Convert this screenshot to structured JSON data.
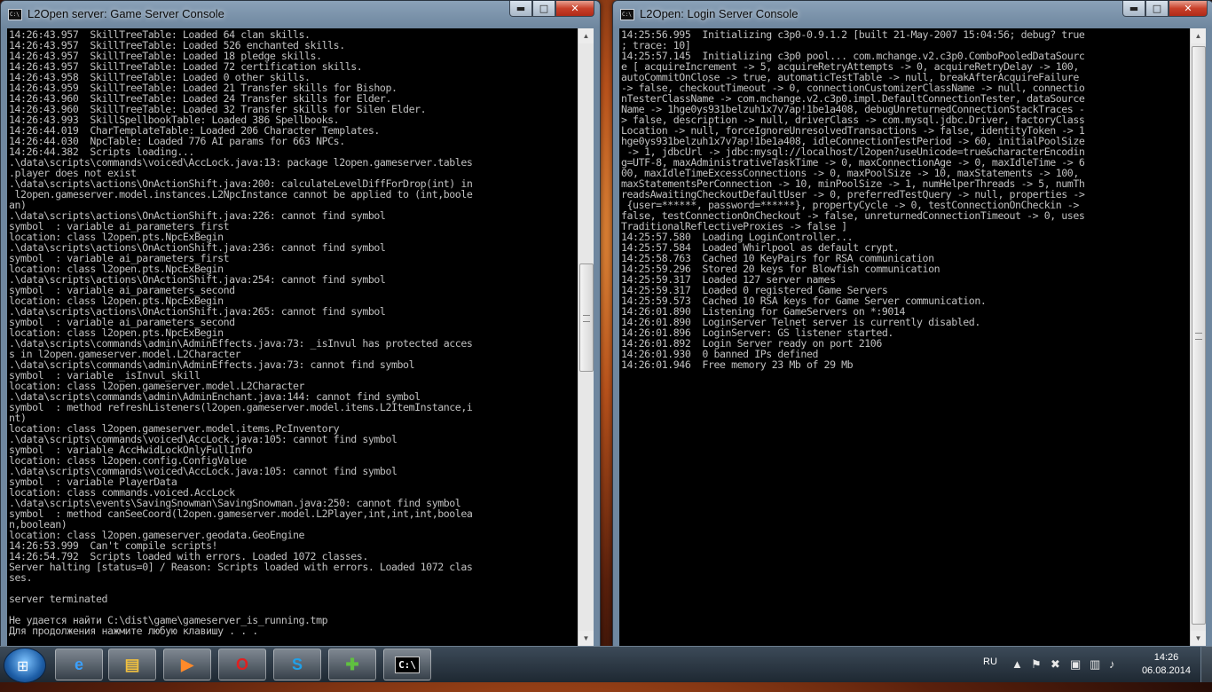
{
  "windows": {
    "game": {
      "title": "L2Open server: Game Server Console",
      "lines": [
        "14:26:43.957  SkillTreeTable: Loaded 64 clan skills.",
        "14:26:43.957  SkillTreeTable: Loaded 526 enchanted skills.",
        "14:26:43.957  SkillTreeTable: Loaded 18 pledge skills.",
        "14:26:43.957  SkillTreeTable: Loaded 72 certification skills.",
        "14:26:43.958  SkillTreeTable: Loaded 0 other skills.",
        "14:26:43.959  SkillTreeTable: Loaded 21 Transfer skills for Bishop.",
        "14:26:43.960  SkillTreeTable: Loaded 24 Transfer skills for Elder.",
        "14:26:43.960  SkillTreeTable: Loaded 32 Transfer skills for Silen Elder.",
        "14:26:43.993  SkillSpellbookTable: Loaded 386 Spellbooks.",
        "14:26:44.019  CharTemplateTable: Loaded 206 Character Templates.",
        "14:26:44.030  NpcTable: Loaded 776 AI params for 663 NPCs.",
        "14:26:44.382  Scripts loading...",
        ".\\data\\scripts\\commands\\voiced\\AccLock.java:13: package l2open.gameserver.tables",
        ".player does not exist",
        ".\\data\\scripts\\actions\\OnActionShift.java:200: calculateLevelDiffForDrop(int) in",
        " l2open.gameserver.model.instances.L2NpcInstance cannot be applied to (int,boole",
        "an)",
        ".\\data\\scripts\\actions\\OnActionShift.java:226: cannot find symbol",
        "symbol  : variable ai_parameters_first",
        "location: class l2open.pts.NpcExBegin",
        ".\\data\\scripts\\actions\\OnActionShift.java:236: cannot find symbol",
        "symbol  : variable ai_parameters_first",
        "location: class l2open.pts.NpcExBegin",
        ".\\data\\scripts\\actions\\OnActionShift.java:254: cannot find symbol",
        "symbol  : variable ai_parameters_second",
        "location: class l2open.pts.NpcExBegin",
        ".\\data\\scripts\\actions\\OnActionShift.java:265: cannot find symbol",
        "symbol  : variable ai_parameters_second",
        "location: class l2open.pts.NpcExBegin",
        ".\\data\\scripts\\commands\\admin\\AdminEffects.java:73: _isInvul has protected acces",
        "s in l2open.gameserver.model.L2Character",
        ".\\data\\scripts\\commands\\admin\\AdminEffects.java:73: cannot find symbol",
        "symbol  : variable _isInvul_skill",
        "location: class l2open.gameserver.model.L2Character",
        ".\\data\\scripts\\commands\\admin\\AdminEnchant.java:144: cannot find symbol",
        "symbol  : method refreshListeners(l2open.gameserver.model.items.L2ItemInstance,i",
        "nt)",
        "location: class l2open.gameserver.model.items.PcInventory",
        ".\\data\\scripts\\commands\\voiced\\AccLock.java:105: cannot find symbol",
        "symbol  : variable AccHwidLockOnlyFullInfo",
        "location: class l2open.config.ConfigValue",
        ".\\data\\scripts\\commands\\voiced\\AccLock.java:105: cannot find symbol",
        "symbol  : variable PlayerData",
        "location: class commands.voiced.AccLock",
        ".\\data\\scripts\\events\\SavingSnowman\\SavingSnowman.java:250: cannot find symbol",
        "symbol  : method canSeeCoord(l2open.gameserver.model.L2Player,int,int,int,boolea",
        "n,boolean)",
        "location: class l2open.gameserver.geodata.GeoEngine",
        "14:26:53.999  Can't compile scripts!",
        "14:26:54.792  Scripts loaded with errors. Loaded 1072 classes.",
        "Server halting [status=0] / Reason: Scripts loaded with errors. Loaded 1072 clas",
        "ses.",
        "",
        "server terminated",
        "",
        "Не удается найти C:\\dist\\game\\gameserver_is_running.tmp",
        "Для продолжения нажмите любую клавишу . . ."
      ]
    },
    "login": {
      "title": "L2Open: Login Server Console",
      "lines": [
        "14:25:56.995  Initializing c3p0-0.9.1.2 [built 21-May-2007 15:04:56; debug? true",
        "; trace: 10]",
        "14:25:57.145  Initializing c3p0 pool... com.mchange.v2.c3p0.ComboPooledDataSourc",
        "e [ acquireIncrement -> 5, acquireRetryAttempts -> 0, acquireRetryDelay -> 100,",
        "autoCommitOnClose -> true, automaticTestTable -> null, breakAfterAcquireFailure",
        "-> false, checkoutTimeout -> 0, connectionCustomizerClassName -> null, connectio",
        "nTesterClassName -> com.mchange.v2.c3p0.impl.DefaultConnectionTester, dataSource",
        "Name -> 1hge0ys931belzuh1x7v7ap!1be1a408, debugUnreturnedConnectionStackTraces -",
        "> false, description -> null, driverClass -> com.mysql.jdbc.Driver, factoryClass",
        "Location -> null, forceIgnoreUnresolvedTransactions -> false, identityToken -> 1",
        "hge0ys931belzuh1x7v7ap!1be1a408, idleConnectionTestPeriod -> 60, initialPoolSize",
        " -> 1, jdbcUrl -> jdbc:mysql://localhost/l2open?useUnicode=true&characterEncodin",
        "g=UTF-8, maxAdministrativeTaskTime -> 0, maxConnectionAge -> 0, maxIdleTime -> 6",
        "00, maxIdleTimeExcessConnections -> 0, maxPoolSize -> 10, maxStatements -> 100,",
        "maxStatementsPerConnection -> 10, minPoolSize -> 1, numHelperThreads -> 5, numTh",
        "readsAwaitingCheckoutDefaultUser -> 0, preferredTestQuery -> null, properties ->",
        " {user=******, password=******}, propertyCycle -> 0, testConnectionOnCheckin ->",
        "false, testConnectionOnCheckout -> false, unreturnedConnectionTimeout -> 0, uses",
        "TraditionalReflectiveProxies -> false ]",
        "14:25:57.580  Loading LoginController...",
        "14:25:57.584  Loaded Whirlpool as default crypt.",
        "14:25:58.763  Cached 10 KeyPairs for RSA communication",
        "14:25:59.296  Stored 20 keys for Blowfish communication",
        "14:25:59.317  Loaded 127 server names",
        "14:25:59.317  Loaded 0 registered Game Servers",
        "14:25:59.573  Cached 10 RSA keys for Game Server communication.",
        "14:26:01.890  Listening for GameServers on *:9014",
        "14:26:01.890  LoginServer Telnet server is currently disabled.",
        "14:26:01.896  LoginServer: GS listener started.",
        "14:26:01.892  Login Server ready on port 2106",
        "14:26:01.930  0 banned IPs defined",
        "14:26:01.946  Free memory 23 Mb of 29 Mb"
      ]
    }
  },
  "caption": {
    "minimize": "▬",
    "maximize": "□",
    "close": "✕"
  },
  "taskbar": {
    "language": "RU",
    "time": "14:26",
    "date": "06.08.2014",
    "items": [
      {
        "name": "internet-explorer-icon",
        "glyph": "e"
      },
      {
        "name": "file-explorer-icon",
        "glyph": "▤"
      },
      {
        "name": "media-player-icon",
        "glyph": "▶"
      },
      {
        "name": "opera-icon",
        "glyph": "O"
      },
      {
        "name": "skype-icon",
        "glyph": "S"
      },
      {
        "name": "green-app-icon",
        "glyph": "✚"
      },
      {
        "name": "command-prompt-icon",
        "glyph": "C:\\"
      }
    ]
  },
  "colors": {
    "console_bg": "#000000",
    "console_fg": "#c0c0c0",
    "close_red": "#c8402a"
  }
}
